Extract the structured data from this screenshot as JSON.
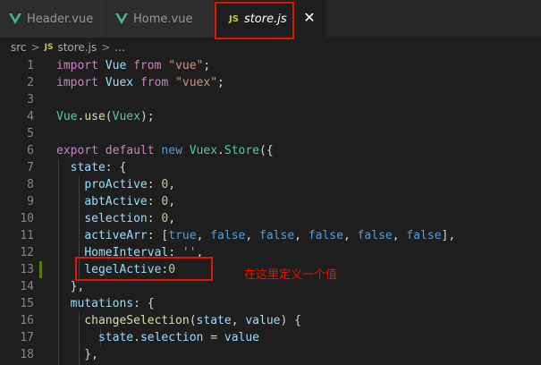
{
  "tabs": [
    {
      "label": "Header.vue",
      "icon": "vue-icon"
    },
    {
      "label": "Home.vue",
      "icon": "vue-icon"
    },
    {
      "label": "store.js",
      "icon": "js-icon",
      "icon_text": "JS",
      "active": true
    }
  ],
  "close_glyph": "✕",
  "breadcrumb": {
    "folder": "src",
    "file": "store.js",
    "sep": ">",
    "ellipsis": "..."
  },
  "code_lines": [
    {
      "n": "1",
      "tokens": [
        [
          "kw",
          "import"
        ],
        [
          "pl",
          " "
        ],
        [
          "prop",
          "Vue"
        ],
        [
          "pl",
          " "
        ],
        [
          "kw",
          "from"
        ],
        [
          "pl",
          " "
        ],
        [
          "str",
          "\"vue\""
        ],
        [
          "pl",
          ";"
        ]
      ]
    },
    {
      "n": "2",
      "tokens": [
        [
          "kw",
          "import"
        ],
        [
          "pl",
          " "
        ],
        [
          "prop",
          "Vuex"
        ],
        [
          "pl",
          " "
        ],
        [
          "kw",
          "from"
        ],
        [
          "pl",
          " "
        ],
        [
          "str",
          "\"vuex\""
        ],
        [
          "pl",
          ";"
        ]
      ]
    },
    {
      "n": "3",
      "tokens": []
    },
    {
      "n": "4",
      "tokens": [
        [
          "ty",
          "Vue"
        ],
        [
          "pl",
          "."
        ],
        [
          "fn",
          "use"
        ],
        [
          "pl",
          "("
        ],
        [
          "ty",
          "Vuex"
        ],
        [
          "pl",
          ");"
        ]
      ]
    },
    {
      "n": "5",
      "tokens": []
    },
    {
      "n": "6",
      "tokens": [
        [
          "kw",
          "export"
        ],
        [
          "pl",
          " "
        ],
        [
          "kw",
          "default"
        ],
        [
          "pl",
          " "
        ],
        [
          "kw2",
          "new"
        ],
        [
          "pl",
          " "
        ],
        [
          "ty",
          "Vuex"
        ],
        [
          "pl",
          "."
        ],
        [
          "ty",
          "Store"
        ],
        [
          "pl",
          "({"
        ]
      ]
    },
    {
      "n": "7",
      "tokens": [
        [
          "pl",
          "  "
        ],
        [
          "prop",
          "state"
        ],
        [
          "pl",
          ": {"
        ]
      ]
    },
    {
      "n": "8",
      "tokens": [
        [
          "pl",
          "    "
        ],
        [
          "prop",
          "proActive"
        ],
        [
          "pl",
          ": "
        ],
        [
          "num",
          "0"
        ],
        [
          "pl",
          ","
        ]
      ]
    },
    {
      "n": "9",
      "tokens": [
        [
          "pl",
          "    "
        ],
        [
          "prop",
          "abtActive"
        ],
        [
          "pl",
          ": "
        ],
        [
          "num",
          "0"
        ],
        [
          "pl",
          ","
        ]
      ]
    },
    {
      "n": "10",
      "tokens": [
        [
          "pl",
          "    "
        ],
        [
          "prop",
          "selection"
        ],
        [
          "pl",
          ": "
        ],
        [
          "num",
          "0"
        ],
        [
          "pl",
          ","
        ]
      ]
    },
    {
      "n": "11",
      "tokens": [
        [
          "pl",
          "    "
        ],
        [
          "prop",
          "activeArr"
        ],
        [
          "pl",
          ": ["
        ],
        [
          "kw2",
          "true"
        ],
        [
          "pl",
          ", "
        ],
        [
          "kw2",
          "false"
        ],
        [
          "pl",
          ", "
        ],
        [
          "kw2",
          "false"
        ],
        [
          "pl",
          ", "
        ],
        [
          "kw2",
          "false"
        ],
        [
          "pl",
          ", "
        ],
        [
          "kw2",
          "false"
        ],
        [
          "pl",
          ", "
        ],
        [
          "kw2",
          "false"
        ],
        [
          "pl",
          "],"
        ]
      ]
    },
    {
      "n": "12",
      "tokens": [
        [
          "pl",
          "    "
        ],
        [
          "prop",
          "HomeInterval"
        ],
        [
          "pl",
          ": "
        ],
        [
          "str",
          "''"
        ],
        [
          "pl",
          ","
        ]
      ]
    },
    {
      "n": "13",
      "tokens": [
        [
          "pl",
          "    "
        ],
        [
          "prop",
          "legelActive"
        ],
        [
          "pl",
          ":"
        ],
        [
          "num",
          "0"
        ]
      ]
    },
    {
      "n": "14",
      "tokens": [
        [
          "pl",
          "  },"
        ]
      ]
    },
    {
      "n": "15",
      "tokens": [
        [
          "pl",
          "  "
        ],
        [
          "prop",
          "mutations"
        ],
        [
          "pl",
          ": {"
        ]
      ]
    },
    {
      "n": "16",
      "tokens": [
        [
          "pl",
          "    "
        ],
        [
          "fn",
          "changeSelection"
        ],
        [
          "pl",
          "("
        ],
        [
          "prop",
          "state"
        ],
        [
          "pl",
          ", "
        ],
        [
          "prop",
          "value"
        ],
        [
          "pl",
          ") {"
        ]
      ]
    },
    {
      "n": "17",
      "tokens": [
        [
          "pl",
          "      "
        ],
        [
          "prop",
          "state"
        ],
        [
          "pl",
          "."
        ],
        [
          "prop",
          "selection"
        ],
        [
          "pl",
          " = "
        ],
        [
          "prop",
          "value"
        ]
      ]
    },
    {
      "n": "18",
      "tokens": [
        [
          "pl",
          "    },"
        ]
      ]
    }
  ],
  "annotation": "在这里定义一个值",
  "colors": {
    "highlight_box": "#e51400",
    "vue_green": "#41b883",
    "js_yellow": "#cbcb41",
    "modified_gutter": "#587c0c"
  }
}
